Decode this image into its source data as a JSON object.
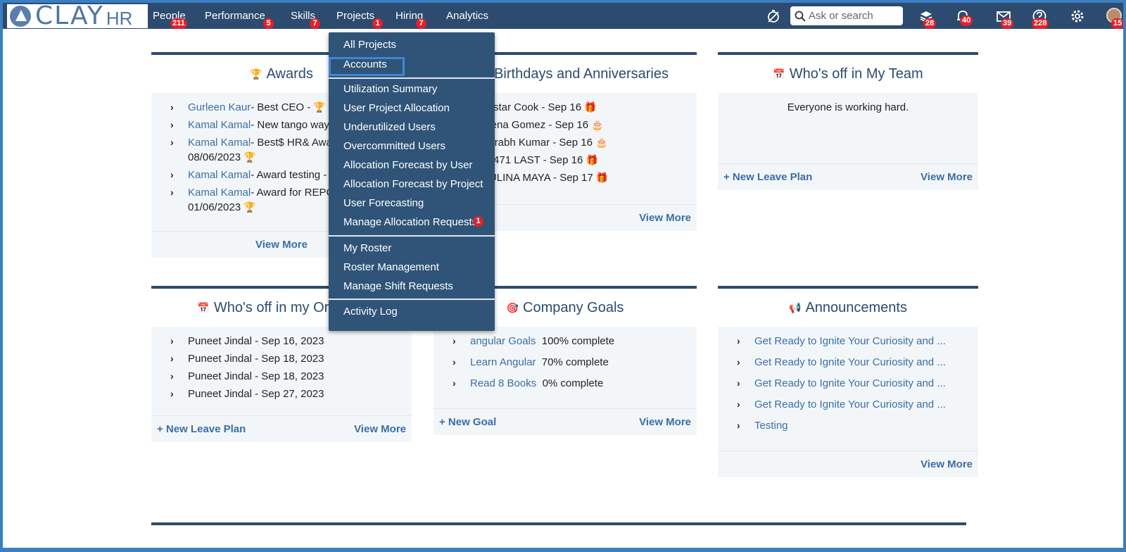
{
  "logo": {
    "clay": "CLAY",
    "hr": "HR"
  },
  "nav": {
    "items": [
      {
        "label": "People",
        "badge": "211"
      },
      {
        "label": "Performance",
        "badge": "5"
      },
      {
        "label": "Skills",
        "badge": "7"
      },
      {
        "label": "Projects",
        "badge": "1"
      },
      {
        "label": "Hiring",
        "badge": "7"
      },
      {
        "label": "Analytics",
        "badge": ""
      }
    ],
    "search_placeholder": "Ask or search",
    "icons": [
      {
        "name": "tasks-icon",
        "badge": "28"
      },
      {
        "name": "bell-icon",
        "badge": "40"
      },
      {
        "name": "mail-icon",
        "badge": "39"
      },
      {
        "name": "help-icon",
        "badge": "228"
      },
      {
        "name": "gear-icon",
        "badge": ""
      },
      {
        "name": "avatar",
        "badge": "15"
      }
    ]
  },
  "dropdown": {
    "items": [
      "All Projects",
      "Accounts",
      "Utilization Summary",
      "User Project Allocation",
      "Underutilized Users",
      "Overcommitted Users",
      "Allocation Forecast by User",
      "Allocation Forecast by Project",
      "User Forecasting",
      "Manage Allocation Requests",
      "My Roster",
      "Roster Management",
      "Manage Shift Requests",
      "Activity Log"
    ],
    "allocation_requests_badge": "1"
  },
  "awards": {
    "title": "Awards",
    "items": [
      {
        "name": "Gurleen Kaur",
        "text": "- Best CEO -",
        "line2": ""
      },
      {
        "name": "Kamal Kamal",
        "text": "- New tango way - 2",
        "line2": ""
      },
      {
        "name": "Kamal Kamal",
        "text": "- Best$ HR& Awar",
        "line2": "08/06/2023"
      },
      {
        "name": "Kamal Kamal",
        "text": "- Award testing - 21/06/2023",
        "line2": ""
      },
      {
        "name": "Kamal Kamal",
        "text": "- Award for REPORTER -",
        "line2": "01/06/2023"
      }
    ],
    "footer": "View More"
  },
  "birthdays": {
    "title": "Birthdays and Anniversaries",
    "items": [
      "Alaistar Cook - Sep 16",
      "Salena Gomez - Sep 16",
      "Saurabh Kumar - Sep 16",
      "135471 LAST - Sep 16",
      "PAULINA MAYA - Sep 17"
    ],
    "footer": "View More"
  },
  "team_off": {
    "title": "Who's off in My Team",
    "message": "Everyone is working hard.",
    "new_leave": "+ New Leave Plan",
    "view_more": "View More"
  },
  "org_off": {
    "title": "Who's off in my Org Unit",
    "items": [
      "Puneet Jindal - Sep 16, 2023",
      "Puneet Jindal - Sep 18, 2023",
      "Puneet Jindal - Sep 18, 2023",
      "Puneet Jindal - Sep 27, 2023"
    ],
    "new_leave": "+ New Leave Plan",
    "view_more": "View More"
  },
  "goals": {
    "title": "Company Goals",
    "items": [
      {
        "name": "angular Goals",
        "progress": "100% complete"
      },
      {
        "name": "Learn Angular",
        "progress": "70% complete"
      },
      {
        "name": "Read 8 Books",
        "progress": "0% complete"
      }
    ],
    "new_goal": "+ New Goal",
    "view_more": "View More"
  },
  "announcements": {
    "title": "Announcements",
    "items": [
      "Get Ready to Ignite Your Curiosity and ...",
      "Get Ready to Ignite Your Curiosity and ...",
      "Get Ready to Ignite Your Curiosity and ...",
      "Get Ready to Ignite Your Curiosity and ...",
      "Testing"
    ],
    "view_more": "View More"
  }
}
